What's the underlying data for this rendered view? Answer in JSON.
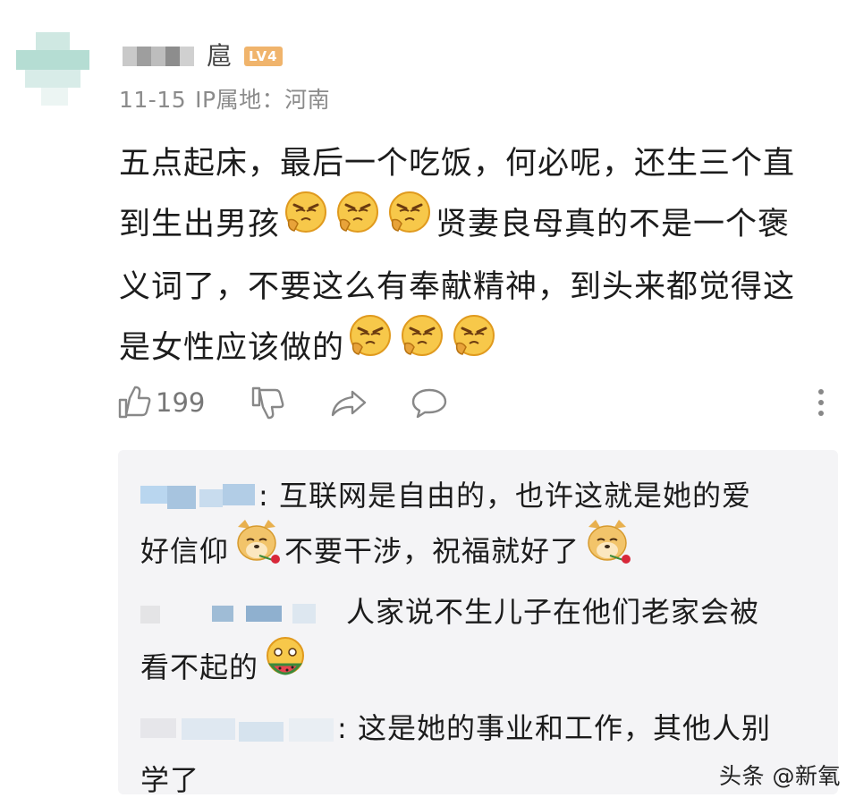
{
  "comment": {
    "username_visible_char": "扈",
    "level_badge": "LV4",
    "date": "11-15",
    "ip_location": "IP属地：河南",
    "lines": [
      "五点起床，最后一个吃饭，何必呢，还生三个直",
      "到生出男孩",
      "贤妻良母真的不是一个褒",
      "义词了，不要这么有奉献精神，到头来都觉得这",
      "是女性应该做的"
    ],
    "emoji_inline": "scheming-face-emoji"
  },
  "actions": {
    "like_icon": "thumbs-up-icon",
    "like_count": "199",
    "dislike_icon": "thumbs-down-icon",
    "share_icon": "share-arrow-icon",
    "reply_icon": "speech-bubble-icon",
    "more_icon": "vertical-dots-icon"
  },
  "replies": [
    {
      "separator": ":",
      "line1": " 互联网是自由的，也许这就是她的爱",
      "line2a": "好信仰",
      "line2b": "不要干涉，祝福就好了",
      "emoji": "doge-with-rose-emoji"
    },
    {
      "line1": "人家说不生儿子在他们老家会被",
      "line2": "看不起的",
      "emoji": "eating-watermelon-emoji"
    },
    {
      "separator": ":",
      "line1": " 这是她的事业和工作，其他人别",
      "line2": "学了"
    }
  ],
  "watermark": "头条 @新氧",
  "colors": {
    "level_badge": "#f0b46c",
    "meta_text": "#8b8b8b",
    "reply_bg": "#f4f4f6",
    "icon_gray": "#888888"
  }
}
